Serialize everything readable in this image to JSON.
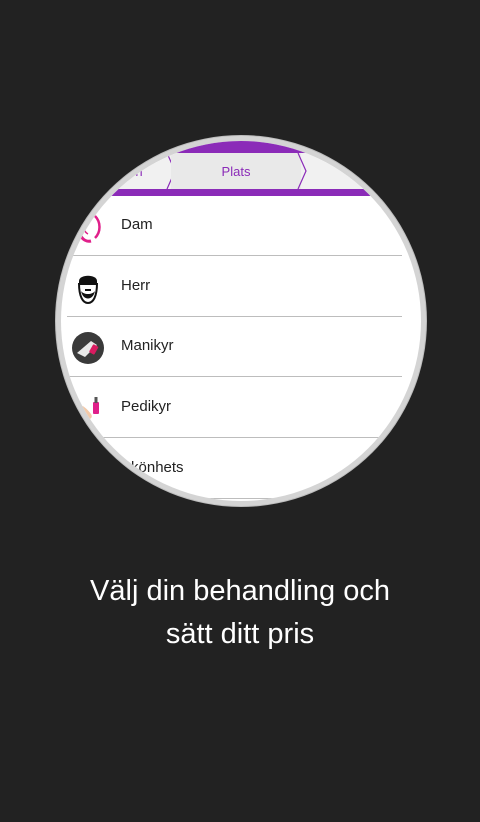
{
  "colors": {
    "background": "#222222",
    "accent": "#8b2bb8",
    "text": "#222222",
    "caption": "#ffffff"
  },
  "steps": {
    "previous": "ption",
    "current": "Plats",
    "next": ""
  },
  "categories": [
    {
      "label": "Dam",
      "icon": "woman-hair-icon"
    },
    {
      "label": "Herr",
      "icon": "bearded-man-icon"
    },
    {
      "label": "Manikyr",
      "icon": "nail-polish-hand-icon"
    },
    {
      "label": "Pedikyr",
      "icon": "foot-polish-icon"
    },
    {
      "label": "Skönhets",
      "icon": "beauty-icon"
    }
  ],
  "caption": {
    "line1": "Välj din behandling och",
    "line2": "sätt ditt pris"
  }
}
